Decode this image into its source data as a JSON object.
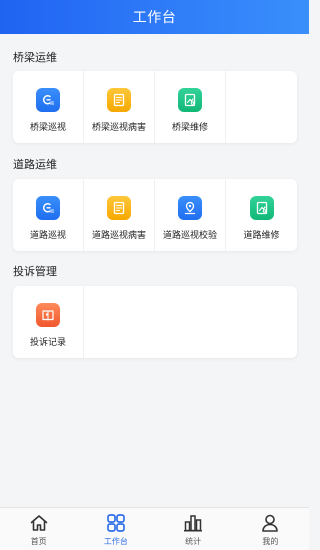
{
  "header": {
    "title": "工作台"
  },
  "sections": [
    {
      "title": "桥梁运维",
      "items": [
        {
          "label": "桥梁巡视",
          "icon": "inspect-icon"
        },
        {
          "label": "桥梁巡视病害",
          "icon": "document-icon"
        },
        {
          "label": "桥梁维修",
          "icon": "repair-icon"
        }
      ]
    },
    {
      "title": "道路运维",
      "items": [
        {
          "label": "道路巡视",
          "icon": "inspect-icon"
        },
        {
          "label": "道路巡视病害",
          "icon": "document-icon"
        },
        {
          "label": "道路巡视校验",
          "icon": "location-icon"
        },
        {
          "label": "道路维修",
          "icon": "repair-icon"
        }
      ]
    },
    {
      "title": "投诉管理",
      "items": [
        {
          "label": "投诉记录",
          "icon": "book-icon"
        }
      ]
    }
  ],
  "tabbar": {
    "items": [
      {
        "label": "首页",
        "icon": "home-icon"
      },
      {
        "label": "工作台",
        "icon": "grid-icon",
        "active": true
      },
      {
        "label": "统计",
        "icon": "bar-chart-icon"
      },
      {
        "label": "我的",
        "icon": "user-icon"
      }
    ]
  },
  "colors": {
    "accent": "#2f6fe8",
    "icon_blue": "#1f6ef0",
    "icon_yellow": "#f6a800",
    "icon_green": "#11b777",
    "icon_orange": "#f0572e"
  }
}
